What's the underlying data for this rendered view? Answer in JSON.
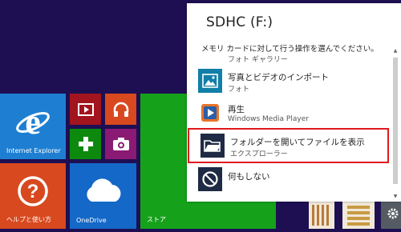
{
  "start": {
    "tiles": [
      {
        "label": "Internet Explorer"
      },
      {
        "label": "ヘルプと使い方"
      },
      {
        "label": "OneDrive"
      },
      {
        "label": "ストア"
      }
    ],
    "colors": {
      "background": "#1e0f52",
      "ie_tile": "#1e7fd2",
      "video_tile": "#a2141e",
      "music_tile": "#d8491f",
      "games_tile": "#0d8a0d",
      "camera_tile": "#8a1a74",
      "help_tile": "#d8491f",
      "onedrive_tile": "#1468c7",
      "store_tile": "#15a21a"
    }
  },
  "toast": {
    "title": "SDHC (F:)",
    "subtitle": "メモリ カードに対して行う操作を選んでください。",
    "partial_item": "フォト ギャラリー",
    "options": [
      {
        "title": "写真とビデオのインポート",
        "subtitle": "フォト",
        "icon": "photos-icon"
      },
      {
        "title": "再生",
        "subtitle": "Windows Media Player",
        "icon": "media-player-icon"
      },
      {
        "title": "フォルダーを開いてファイルを表示",
        "subtitle": "エクスプローラー",
        "icon": "folder-icon",
        "selected": true
      },
      {
        "title": "何もしない",
        "subtitle": "",
        "icon": "no-action-icon"
      }
    ],
    "highlight_color": "#e0191e"
  }
}
